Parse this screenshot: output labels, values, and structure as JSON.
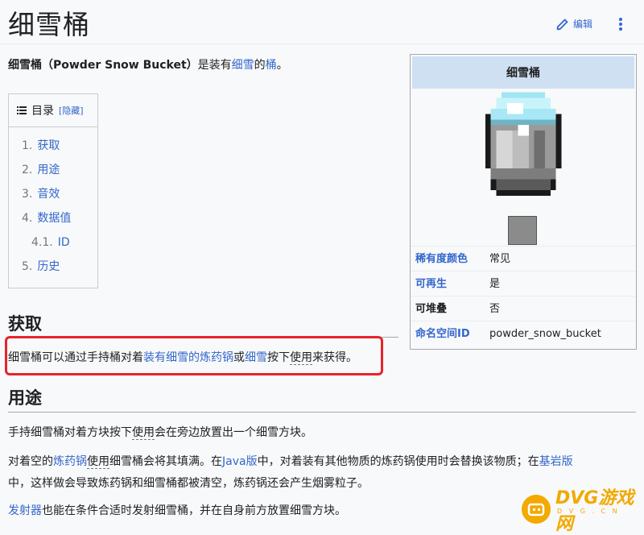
{
  "page": {
    "title": "细雪桶",
    "edit_label": "编辑"
  },
  "intro": {
    "bold": "细雪桶（Powder Snow Bucket）",
    "text1": "是装有",
    "link1": "细雪",
    "text2": "的",
    "link2": "桶",
    "text3": "。"
  },
  "toc": {
    "title": "目录",
    "hide_label": "[隐藏]",
    "items": [
      {
        "num": "1.",
        "label": "获取"
      },
      {
        "num": "2.",
        "label": "用途"
      },
      {
        "num": "3.",
        "label": "音效"
      },
      {
        "num": "4.",
        "label": "数据值"
      },
      {
        "num": "4.1.",
        "label": "ID"
      },
      {
        "num": "5.",
        "label": "历史"
      }
    ]
  },
  "obtain": {
    "heading": "获取",
    "t1": "细雪桶可以通过手持桶对着",
    "l1": "装有细雪的炼药锅",
    "t2": "或",
    "l2": "细雪",
    "t3": "按下",
    "t4": "使用",
    "t5": "来获得。"
  },
  "usage": {
    "heading": "用途",
    "p1a": "手持细雪桶对着方块按下",
    "p1b": "使用",
    "p1c": "会在旁边放置出一个细雪方块。",
    "p2a": "对着空的",
    "p2b": "炼药锅",
    "p2c": "使用",
    "p2d": "细雪桶会将其填满。在",
    "p2e": "Java版",
    "p2f": "中，对着装有其他物质的炼药锅使用时会替换该物质；在",
    "p2g": "基岩版",
    "p3": "中，这样做会导致炼药锅和细雪桶都被清空，炼药锅还会产生烟雾粒子。",
    "p4a": "发射器",
    "p4b": "也能在条件合适时发射细雪桶，并在自身前方放置细雪方块。"
  },
  "infobox": {
    "title": "细雪桶",
    "rows": [
      {
        "key": "稀有度颜色",
        "value": "常见"
      },
      {
        "key": "可再生",
        "value": "是"
      },
      {
        "key": "可堆叠",
        "value": "否"
      },
      {
        "key": "命名空间ID",
        "value": "powder_snow_bucket"
      }
    ]
  },
  "watermark": {
    "text": "DVG游戏网",
    "sub": "D V G . C N"
  },
  "icons": [
    "edit-pencil-icon",
    "more-vertical-icon",
    "toc-list-icon",
    "powder-snow-bucket-icon",
    "dvg-logo-icon"
  ]
}
